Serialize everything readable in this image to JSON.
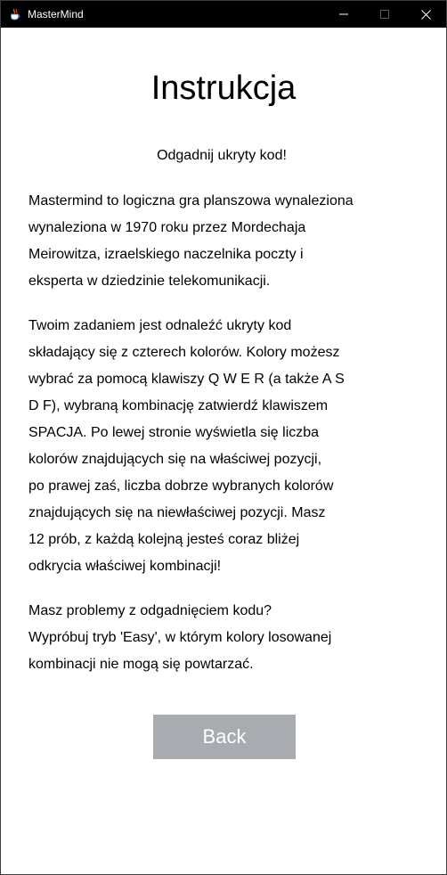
{
  "window": {
    "title": "MasterMind"
  },
  "instructions": {
    "heading": "Instrukcja",
    "subheading": "Odgadnij ukryty kod!",
    "paragraph1": [
      "Mastermind to logiczna gra planszowa wynaleziona",
      "wynaleziona w 1970 roku przez Mordechaja",
      "Meirowitza, izraelskiego naczelnika poczty i",
      "eksperta w dziedzinie telekomunikacji."
    ],
    "paragraph2": [
      "Twoim zadaniem jest odnaleźć ukryty kod",
      "składający się z czterech kolorów. Kolory możesz",
      "wybrać za pomocą klawiszy Q W E R (a także A S",
      "D F), wybraną kombinację zatwierdź klawiszem",
      "SPACJA. Po lewej stronie wyświetla się liczba",
      "kolorów znajdujących się na właściwej pozycji,",
      "po prawej zaś, liczba dobrze wybranych kolorów",
      "znajdujących się na niewłaściwej pozycji. Masz",
      "12 prób, z każdą kolejną jesteś coraz bliżej",
      "odkrycia właściwej kombinacji!"
    ],
    "paragraph3": [
      "Masz problemy z odgadnięciem kodu?",
      "Wypróbuj tryb 'Easy', w którym kolory losowanej",
      "kombinacji nie mogą się powtarzać."
    ],
    "back_label": "Back"
  },
  "colors": {
    "titlebar": "#000000",
    "background": "#ffffff",
    "button": "#a8acb0",
    "button_text": "#ffffff"
  },
  "icons": {
    "app": "java-cup-icon",
    "minimize": "minimize-icon",
    "maximize": "maximize-icon",
    "close": "close-icon"
  }
}
